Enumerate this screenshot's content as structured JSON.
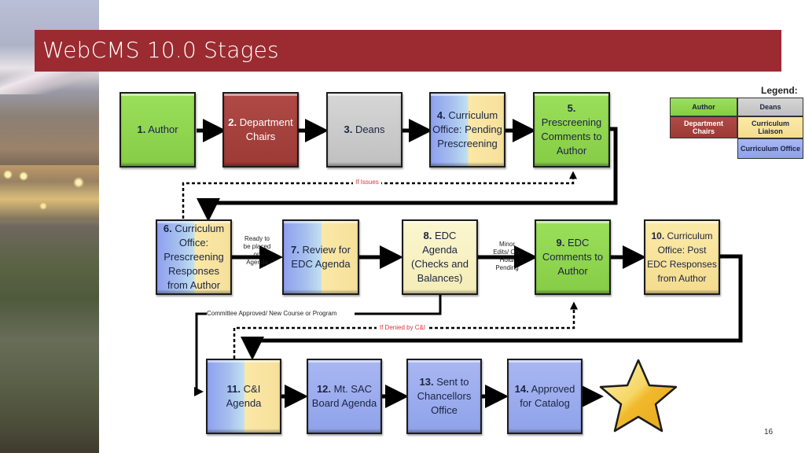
{
  "slide": {
    "title": "WebCMS 10.0 Stages",
    "page_number": "16"
  },
  "legend": {
    "title": "Legend:",
    "items": [
      {
        "label": "Author",
        "color": "#86cc45"
      },
      {
        "label": "Deans",
        "color": "#c8c8c8"
      },
      {
        "label": "Department Chairs",
        "color": "#9c3a36"
      },
      {
        "label": "Curriculum Liaison",
        "color": "#f6e09b"
      },
      {
        "label": "Curriculum Office",
        "color": "#98a9ee"
      }
    ]
  },
  "stages": [
    {
      "num": "1.",
      "text": "Author",
      "role": "Author"
    },
    {
      "num": "2.",
      "text": "Department Chairs",
      "role": "Department Chairs"
    },
    {
      "num": "3.",
      "text": "Deans",
      "role": "Deans"
    },
    {
      "num": "4.",
      "text": "Curriculum Office: Pending Prescreening",
      "role": "Curriculum Office / Curriculum Liaison"
    },
    {
      "num": "5.",
      "text": "Prescreening Comments to Author",
      "role": "Author"
    },
    {
      "num": "6.",
      "text": "Curriculum Office: Prescreening Responses from Author",
      "role": "Curriculum Office / Curriculum Liaison"
    },
    {
      "num": "7.",
      "text": "Review for EDC Agenda",
      "role": "Curriculum Office / Curriculum Liaison"
    },
    {
      "num": "8.",
      "text": "EDC Agenda (Checks and Balances)",
      "role": "EDC"
    },
    {
      "num": "9.",
      "text": "EDC Comments to Author",
      "role": "Author"
    },
    {
      "num": "10.",
      "text": "Curriculum Office: Post EDC Responses from Author",
      "role": "Curriculum Liaison"
    },
    {
      "num": "11.",
      "text": "C&I Agenda",
      "role": "Curriculum Office / Curriculum Liaison"
    },
    {
      "num": "12.",
      "text": "Mt. SAC Board Agenda",
      "role": "Curriculum Office"
    },
    {
      "num": "13.",
      "text": "Sent to Chancellors Office",
      "role": "Curriculum Office"
    },
    {
      "num": "14.",
      "text": "Approved for Catalog",
      "role": "Curriculum Office"
    }
  ],
  "connector_labels": {
    "if_issues": "If Issues",
    "ready": "Ready to be placed on Agenda",
    "minor_edits": "Minor Edits/ On-Hold/ Pending",
    "committee_approved": "Committee Approved/ New Course or Program",
    "if_denied": "If Denied by C&I"
  },
  "end_icon": "star-icon",
  "colors": {
    "title_bar": "#9b2b30",
    "conditional_label": "#e2323a"
  }
}
